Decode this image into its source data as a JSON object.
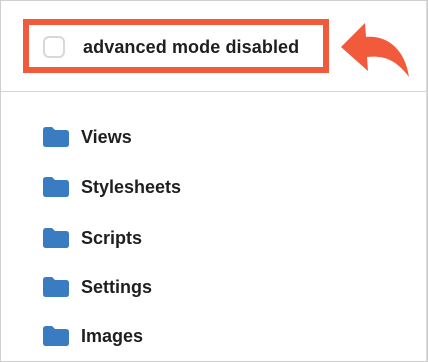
{
  "advanced_mode": {
    "checked": false,
    "label": "advanced mode disabled"
  },
  "accent_color": "#f15a3a",
  "folder_color": "#3a7cc1",
  "folders": [
    {
      "label": "Views",
      "icon": "folder-icon"
    },
    {
      "label": "Stylesheets",
      "icon": "folder-icon"
    },
    {
      "label": "Scripts",
      "icon": "folder-icon"
    },
    {
      "label": "Settings",
      "icon": "folder-icon"
    },
    {
      "label": "Images",
      "icon": "folder-icon"
    }
  ]
}
